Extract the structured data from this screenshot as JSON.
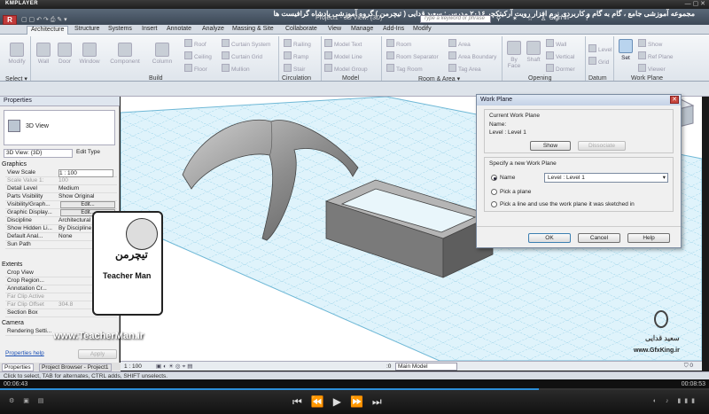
{
  "player": {
    "logo": "KMPLAYER",
    "controls": "— ▢ ✕",
    "time_current": "00:06:43",
    "time_total": "00:08:53",
    "progress": 0.76
  },
  "course_title": "مجموعه آموزشی جامع ، گام به گام و کاربردی نرم افزار رویت آرکیتکچر ۲۰۱۶   مدرس : سعید قدایی ( تیچرمن ) گروه آموزشی پادشاه گرافیست ها",
  "app": {
    "doc_title": "Project1 - 3D View: {3D}",
    "search_placeholder": "Type a keyword or phrase",
    "sign_in": "Sign In"
  },
  "ribbon": {
    "tabs": [
      "Architecture",
      "Structure",
      "Systems",
      "Insert",
      "Annotate",
      "Analyze",
      "Massing & Site",
      "Collaborate",
      "View",
      "Manage",
      "Add-Ins",
      "Modify"
    ],
    "active_tab": "Architecture",
    "buttons": {
      "modify": "Modify",
      "wall": "Wall",
      "door": "Door",
      "window": "Window",
      "component": "Component",
      "column": "Column",
      "roof": "Roof",
      "ceiling": "Ceiling",
      "floor": "Floor",
      "curtain_system": "Curtain System",
      "curtain_grid": "Curtain Grid",
      "mullion": "Mullion",
      "railing": "Railing",
      "ramp": "Ramp",
      "stair": "Stair",
      "model_text": "Model Text",
      "model_line": "Model Line",
      "model_group": "Model Group",
      "room": "Room",
      "room_separator": "Room Separator",
      "tag_room": "Tag Room",
      "area": "Area",
      "area_boundary": "Area Boundary",
      "tag_area": "Tag Area",
      "by_face": "By Face",
      "shaft": "Shaft",
      "wall_open": "Wall",
      "vertical": "Vertical",
      "dormer": "Dormer",
      "level": "Level",
      "grid": "Grid",
      "set": "Set",
      "show": "Show",
      "ref_plane": "Ref Plane",
      "viewer": "Viewer"
    },
    "panels": [
      "Select ▾",
      "Build",
      "Circulation",
      "Model",
      "Room & Area ▾",
      "Opening",
      "Datum",
      "Work Plane"
    ]
  },
  "properties": {
    "title": "Properties",
    "type_name": "3D View",
    "view_selector": "3D View: {3D}",
    "edit_type": "Edit Type",
    "groups": {
      "graphics": "Graphics",
      "extents": "Extents",
      "camera": "Camera"
    },
    "rows": [
      {
        "k": "View Scale",
        "v": "1 : 100"
      },
      {
        "k": "Scale Value   1:",
        "v": "100"
      },
      {
        "k": "Detail Level",
        "v": "Medium"
      },
      {
        "k": "Parts Visibility",
        "v": "Show Original"
      },
      {
        "k": "Visibility/Graph...",
        "v": "Edit..."
      },
      {
        "k": "Graphic Display...",
        "v": "Edit..."
      },
      {
        "k": "Discipline",
        "v": "Architectural"
      },
      {
        "k": "Show Hidden Li...",
        "v": "By Discipline"
      },
      {
        "k": "Default Anal...",
        "v": "None"
      },
      {
        "k": "Sun Path",
        "v": ""
      }
    ],
    "extent_rows": [
      {
        "k": "Crop View",
        "v": ""
      },
      {
        "k": "Crop Region...",
        "v": ""
      },
      {
        "k": "Annotation Cr...",
        "v": ""
      },
      {
        "k": "Far Clip Active",
        "v": ""
      },
      {
        "k": "Far Clip Offset",
        "v": "304.8"
      },
      {
        "k": "Section Box",
        "v": ""
      }
    ],
    "camera_rows": [
      {
        "k": "Rendering Setti...",
        "v": ""
      }
    ],
    "help_link": "Properties help",
    "apply": "Apply",
    "tab_properties": "Properties",
    "tab_browser": "Project Browser - Project1"
  },
  "viewbar": {
    "scale": "1 : 100",
    "model": "Main Model",
    "zero": ":0"
  },
  "status": {
    "text": "Click to select, TAB for alternates, CTRL adds, SHIFT unselects."
  },
  "dialog": {
    "title": "Work Plane",
    "current_label": "Current Work Plane",
    "name_label": "Name:",
    "current_value": "Level : Level 1",
    "show": "Show",
    "dissociate": "Dissociate",
    "specify_label": "Specify a new Work Plane",
    "opt_name": "Name",
    "select_value": "Level : Level 1",
    "opt_pick": "Pick a plane",
    "opt_line": "Pick a line and use the work plane it was sketched in",
    "ok": "OK",
    "cancel": "Cancel",
    "help": "Help"
  },
  "overlays": {
    "teacher_logo": "تیچرمن",
    "teacher_name": "Teacher Man",
    "site": "www.TeacherMan.ir",
    "gfx_author": "سعید قدایی",
    "gfx_site": "www.GfxKing.ir"
  },
  "colors": {
    "grid_fill": "#dff3fb",
    "grid_line": "#7fc6e2",
    "dome": "#9a9a9a",
    "wall_top": "#b5b5b5",
    "wall_side": "#6e6e6e"
  }
}
